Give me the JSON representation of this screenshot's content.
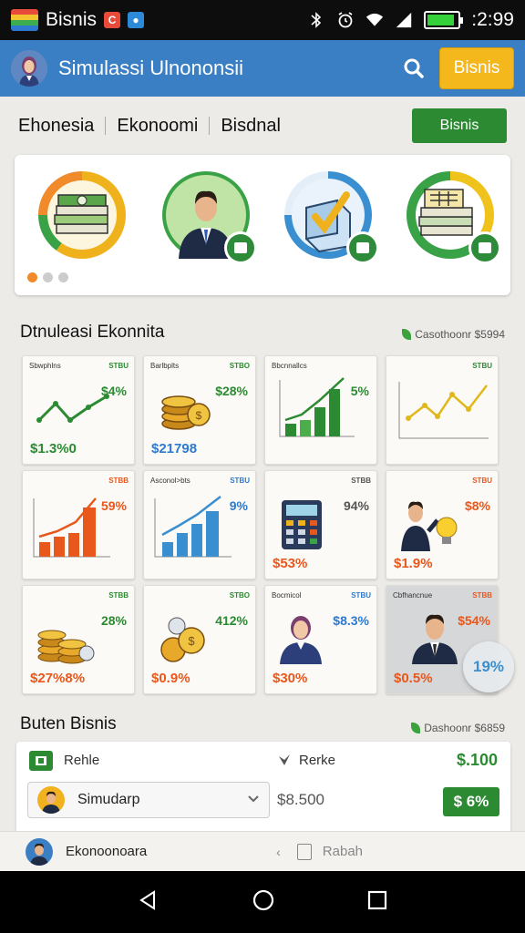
{
  "statusbar": {
    "app_title": "Bisnis",
    "badge1": "C",
    "badge2": "●",
    "time": ":2:99",
    "battery_level": 0.9
  },
  "appbar": {
    "title": "Simulassi Ulnononsii",
    "button": "Bisnis"
  },
  "tabs": [
    {
      "label": "Ehonesia"
    },
    {
      "label": "Ekonoomi"
    },
    {
      "label": "Bisdnal"
    }
  ],
  "tab_action": "Bisnis",
  "carousel": {
    "items": [
      "stack-of-money-icon",
      "businessman-icon",
      "checkbox-icon",
      "money-stack-icon"
    ],
    "active_index": 0,
    "count": 3
  },
  "section1": {
    "title": "Dtnuleasi Ekonnita",
    "right_label": "Casothoonr $5994"
  },
  "cards": [
    {
      "top_left": "Sbwphlns",
      "top_right": "STBU",
      "pct": "$4%",
      "value": "$1.3%0",
      "visual": "line-chart",
      "pct_color": "#2b8a32",
      "value_color": "#2b8a32"
    },
    {
      "top_left": "Barlbplts",
      "top_right": "STBO",
      "pct": "$28%",
      "value": "$21798",
      "visual": "coins",
      "pct_color": "#2b8a32",
      "value_color": "#2d7ad0"
    },
    {
      "top_left": "Bbcnnallcs",
      "top_right": "",
      "pct": "5%",
      "value": "",
      "visual": "bar-chart-green",
      "pct_color": "#2b8a32",
      "value_color": "#2b8a32"
    },
    {
      "top_left": "",
      "top_right": "STBU",
      "pct": "",
      "value": "",
      "visual": "line-chart-yellow",
      "pct_color": "#2b8a32",
      "value_color": "#2b8a32"
    },
    {
      "top_left": "",
      "top_right": "STBB",
      "pct": "59%",
      "value": "",
      "visual": "bar-chart-orange",
      "pct_color": "#e8571c",
      "value_color": "#e8571c"
    },
    {
      "top_left": "Asconol>bts",
      "top_right": "STBU",
      "pct": "9%",
      "value": "",
      "visual": "bar-chart-blue",
      "pct_color": "#2d7ad0",
      "value_color": "#2d7ad0"
    },
    {
      "top_left": "",
      "top_right": "STBB",
      "pct": "94%",
      "value": "$53%",
      "visual": "calculator",
      "pct_color": "#555",
      "value_color": "#e8571c"
    },
    {
      "top_left": "",
      "top_right": "STBU",
      "pct": "$8%",
      "value": "$1.9%",
      "visual": "man-bulb",
      "pct_color": "#e8571c",
      "value_color": "#e8571c"
    },
    {
      "top_left": "",
      "top_right": "STBB",
      "pct": "28%",
      "value": "$27%8%",
      "visual": "coin-stacks",
      "pct_color": "#2b8a32",
      "value_color": "#e8571c"
    },
    {
      "top_left": "",
      "top_right": "STBO",
      "pct": "412%",
      "value": "$0.9%",
      "visual": "coins2",
      "pct_color": "#2b8a32",
      "value_color": "#e8571c"
    },
    {
      "top_left": "Bocmicol",
      "top_right": "STBU",
      "pct": "$8.3%",
      "value": "$30%",
      "visual": "woman",
      "pct_color": "#2d7ad0",
      "value_color": "#e8571c"
    },
    {
      "top_left": "Cbfhancnue",
      "top_right": "STBB",
      "pct": "$54%",
      "value": "$0.5%",
      "visual": "man",
      "pct_color": "#e8571c",
      "value_color": "#e8571c"
    }
  ],
  "fab": "19%",
  "section2": {
    "title": "Buten Bisnis",
    "right_label": "Dashoonr $6859"
  },
  "list": {
    "row1_left": "Rehle",
    "row1_mid": "Rerke",
    "row1_right": "$.100",
    "select_label": "Simudarp",
    "mid_value": "$8.500",
    "pill": "$ 6%"
  },
  "bottom_bar": {
    "left": "Ekonoonoara",
    "mid": "Rabah"
  },
  "colors": {
    "accent_blue": "#3a7fc4",
    "green": "#2b8a32",
    "orange": "#e8571c",
    "yellow": "#f4b81c"
  }
}
